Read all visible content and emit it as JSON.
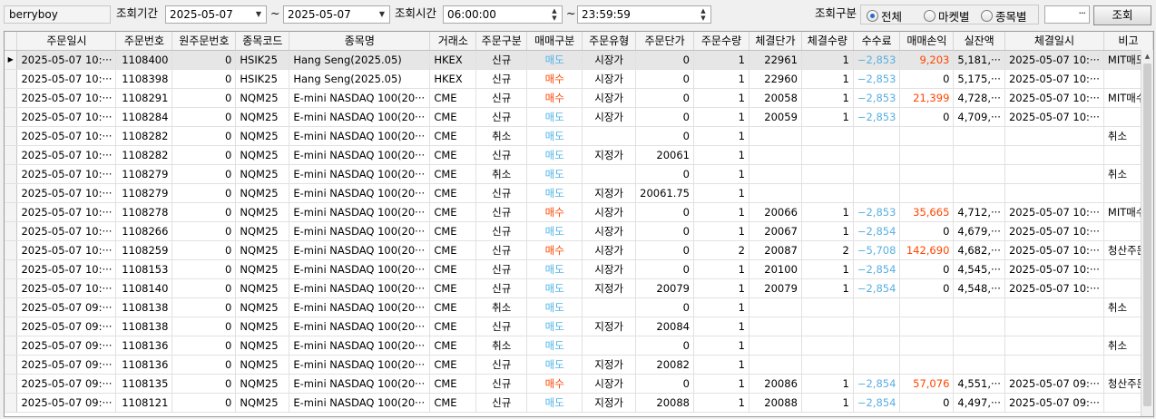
{
  "toolbar": {
    "user": "berryboy",
    "period_label": "조회기간",
    "date_from": "2025-05-07",
    "tilde": "~",
    "date_to": "2025-05-07",
    "time_label": "조회시간",
    "time_from": "06:00:00",
    "time_to": "23:59:59",
    "category_label": "조회구분",
    "radio_all": "전체",
    "radio_market": "마켓별",
    "radio_symbol": "종목별",
    "more_label": "···",
    "query_button": "조회"
  },
  "table": {
    "columns": [
      "주문일시",
      "주문번호",
      "원주문번호",
      "종목코드",
      "종목명",
      "거래소",
      "주문구분",
      "매매구분",
      "주문유형",
      "주문단가",
      "주문수량",
      "체결단가",
      "체결수량",
      "수수료",
      "매매손익",
      "실잔액",
      "체결일시",
      "비고"
    ],
    "rows": [
      {
        "order_time": "2025-05-07 10:···",
        "order_no": "1108400",
        "orig_no": "0",
        "code": "HSIK25",
        "name": "Hang Seng(2025.05)",
        "exchange": "HKEX",
        "order_type": "신규",
        "side": "매도",
        "price_type": "시장가",
        "order_price": "0",
        "order_qty": "1",
        "fill_price": "22961",
        "fill_qty": "1",
        "fee": "−2,853",
        "pl": "9,203",
        "balance": "5,181,···",
        "fill_time": "2025-05-07 10:···",
        "note": "MIT매도"
      },
      {
        "order_time": "2025-05-07 10:···",
        "order_no": "1108398",
        "orig_no": "0",
        "code": "HSIK25",
        "name": "Hang Seng(2025.05)",
        "exchange": "HKEX",
        "order_type": "신규",
        "side": "매수",
        "price_type": "시장가",
        "order_price": "0",
        "order_qty": "1",
        "fill_price": "22960",
        "fill_qty": "1",
        "fee": "−2,853",
        "pl": "0",
        "balance": "5,175,···",
        "fill_time": "2025-05-07 10:···",
        "note": ""
      },
      {
        "order_time": "2025-05-07 10:···",
        "order_no": "1108291",
        "orig_no": "0",
        "code": "NQM25",
        "name": "E-mini NASDAQ 100(20···",
        "exchange": "CME",
        "order_type": "신규",
        "side": "매수",
        "price_type": "시장가",
        "order_price": "0",
        "order_qty": "1",
        "fill_price": "20058",
        "fill_qty": "1",
        "fee": "−2,853",
        "pl": "21,399",
        "balance": "4,728,···",
        "fill_time": "2025-05-07 10:···",
        "note": "MIT매수"
      },
      {
        "order_time": "2025-05-07 10:···",
        "order_no": "1108284",
        "orig_no": "0",
        "code": "NQM25",
        "name": "E-mini NASDAQ 100(20···",
        "exchange": "CME",
        "order_type": "신규",
        "side": "매도",
        "price_type": "시장가",
        "order_price": "0",
        "order_qty": "1",
        "fill_price": "20059",
        "fill_qty": "1",
        "fee": "−2,853",
        "pl": "0",
        "balance": "4,709,···",
        "fill_time": "2025-05-07 10:···",
        "note": ""
      },
      {
        "order_time": "2025-05-07 10:···",
        "order_no": "1108282",
        "orig_no": "0",
        "code": "NQM25",
        "name": "E-mini NASDAQ 100(20···",
        "exchange": "CME",
        "order_type": "취소",
        "side": "매도",
        "price_type": "",
        "order_price": "0",
        "order_qty": "1",
        "fill_price": "",
        "fill_qty": "",
        "fee": "",
        "pl": "",
        "balance": "",
        "fill_time": "",
        "note": "취소"
      },
      {
        "order_time": "2025-05-07 10:···",
        "order_no": "1108282",
        "orig_no": "0",
        "code": "NQM25",
        "name": "E-mini NASDAQ 100(20···",
        "exchange": "CME",
        "order_type": "신규",
        "side": "매도",
        "price_type": "지정가",
        "order_price": "20061",
        "order_qty": "1",
        "fill_price": "",
        "fill_qty": "",
        "fee": "",
        "pl": "",
        "balance": "",
        "fill_time": "",
        "note": ""
      },
      {
        "order_time": "2025-05-07 10:···",
        "order_no": "1108279",
        "orig_no": "0",
        "code": "NQM25",
        "name": "E-mini NASDAQ 100(20···",
        "exchange": "CME",
        "order_type": "취소",
        "side": "매도",
        "price_type": "",
        "order_price": "0",
        "order_qty": "1",
        "fill_price": "",
        "fill_qty": "",
        "fee": "",
        "pl": "",
        "balance": "",
        "fill_time": "",
        "note": "취소"
      },
      {
        "order_time": "2025-05-07 10:···",
        "order_no": "1108279",
        "orig_no": "0",
        "code": "NQM25",
        "name": "E-mini NASDAQ 100(20···",
        "exchange": "CME",
        "order_type": "신규",
        "side": "매도",
        "price_type": "지정가",
        "order_price": "20061.75",
        "order_qty": "1",
        "fill_price": "",
        "fill_qty": "",
        "fee": "",
        "pl": "",
        "balance": "",
        "fill_time": "",
        "note": ""
      },
      {
        "order_time": "2025-05-07 10:···",
        "order_no": "1108278",
        "orig_no": "0",
        "code": "NQM25",
        "name": "E-mini NASDAQ 100(20···",
        "exchange": "CME",
        "order_type": "신규",
        "side": "매수",
        "price_type": "시장가",
        "order_price": "0",
        "order_qty": "1",
        "fill_price": "20066",
        "fill_qty": "1",
        "fee": "−2,853",
        "pl": "35,665",
        "balance": "4,712,···",
        "fill_time": "2025-05-07 10:···",
        "note": "MIT매수"
      },
      {
        "order_time": "2025-05-07 10:···",
        "order_no": "1108266",
        "orig_no": "0",
        "code": "NQM25",
        "name": "E-mini NASDAQ 100(20···",
        "exchange": "CME",
        "order_type": "신규",
        "side": "매도",
        "price_type": "시장가",
        "order_price": "0",
        "order_qty": "1",
        "fill_price": "20067",
        "fill_qty": "1",
        "fee": "−2,854",
        "pl": "0",
        "balance": "4,679,···",
        "fill_time": "2025-05-07 10:···",
        "note": ""
      },
      {
        "order_time": "2025-05-07 10:···",
        "order_no": "1108259",
        "orig_no": "0",
        "code": "NQM25",
        "name": "E-mini NASDAQ 100(20···",
        "exchange": "CME",
        "order_type": "신규",
        "side": "매수",
        "price_type": "시장가",
        "order_price": "0",
        "order_qty": "2",
        "fill_price": "20087",
        "fill_qty": "2",
        "fee": "−5,708",
        "pl": "142,690",
        "balance": "4,682,···",
        "fill_time": "2025-05-07 10:···",
        "note": "청산주문"
      },
      {
        "order_time": "2025-05-07 10:···",
        "order_no": "1108153",
        "orig_no": "0",
        "code": "NQM25",
        "name": "E-mini NASDAQ 100(20···",
        "exchange": "CME",
        "order_type": "신규",
        "side": "매도",
        "price_type": "시장가",
        "order_price": "0",
        "order_qty": "1",
        "fill_price": "20100",
        "fill_qty": "1",
        "fee": "−2,854",
        "pl": "0",
        "balance": "4,545,···",
        "fill_time": "2025-05-07 10:···",
        "note": ""
      },
      {
        "order_time": "2025-05-07 10:···",
        "order_no": "1108140",
        "orig_no": "0",
        "code": "NQM25",
        "name": "E-mini NASDAQ 100(20···",
        "exchange": "CME",
        "order_type": "신규",
        "side": "매도",
        "price_type": "지정가",
        "order_price": "20079",
        "order_qty": "1",
        "fill_price": "20079",
        "fill_qty": "1",
        "fee": "−2,854",
        "pl": "0",
        "balance": "4,548,···",
        "fill_time": "2025-05-07 10:···",
        "note": ""
      },
      {
        "order_time": "2025-05-07 09:···",
        "order_no": "1108138",
        "orig_no": "0",
        "code": "NQM25",
        "name": "E-mini NASDAQ 100(20···",
        "exchange": "CME",
        "order_type": "취소",
        "side": "매도",
        "price_type": "",
        "order_price": "0",
        "order_qty": "1",
        "fill_price": "",
        "fill_qty": "",
        "fee": "",
        "pl": "",
        "balance": "",
        "fill_time": "",
        "note": "취소"
      },
      {
        "order_time": "2025-05-07 09:···",
        "order_no": "1108138",
        "orig_no": "0",
        "code": "NQM25",
        "name": "E-mini NASDAQ 100(20···",
        "exchange": "CME",
        "order_type": "신규",
        "side": "매도",
        "price_type": "지정가",
        "order_price": "20084",
        "order_qty": "1",
        "fill_price": "",
        "fill_qty": "",
        "fee": "",
        "pl": "",
        "balance": "",
        "fill_time": "",
        "note": ""
      },
      {
        "order_time": "2025-05-07 09:···",
        "order_no": "1108136",
        "orig_no": "0",
        "code": "NQM25",
        "name": "E-mini NASDAQ 100(20···",
        "exchange": "CME",
        "order_type": "취소",
        "side": "매도",
        "price_type": "",
        "order_price": "0",
        "order_qty": "1",
        "fill_price": "",
        "fill_qty": "",
        "fee": "",
        "pl": "",
        "balance": "",
        "fill_time": "",
        "note": "취소"
      },
      {
        "order_time": "2025-05-07 09:···",
        "order_no": "1108136",
        "orig_no": "0",
        "code": "NQM25",
        "name": "E-mini NASDAQ 100(20···",
        "exchange": "CME",
        "order_type": "신규",
        "side": "매도",
        "price_type": "지정가",
        "order_price": "20082",
        "order_qty": "1",
        "fill_price": "",
        "fill_qty": "",
        "fee": "",
        "pl": "",
        "balance": "",
        "fill_time": "",
        "note": ""
      },
      {
        "order_time": "2025-05-07 09:···",
        "order_no": "1108135",
        "orig_no": "0",
        "code": "NQM25",
        "name": "E-mini NASDAQ 100(20···",
        "exchange": "CME",
        "order_type": "신규",
        "side": "매수",
        "price_type": "시장가",
        "order_price": "0",
        "order_qty": "1",
        "fill_price": "20086",
        "fill_qty": "1",
        "fee": "−2,854",
        "pl": "57,076",
        "balance": "4,551,···",
        "fill_time": "2025-05-07 09:···",
        "note": "청산주문"
      },
      {
        "order_time": "2025-05-07 09:···",
        "order_no": "1108121",
        "orig_no": "0",
        "code": "NQM25",
        "name": "E-mini NASDAQ 100(20···",
        "exchange": "CME",
        "order_type": "신규",
        "side": "매도",
        "price_type": "지정가",
        "order_price": "20088",
        "order_qty": "1",
        "fill_price": "20088",
        "fill_qty": "1",
        "fee": "−2,854",
        "pl": "0",
        "balance": "4,497,···",
        "fill_time": "2025-05-07 09:···",
        "note": ""
      }
    ]
  },
  "colors": {
    "sell": "#4fb3e8",
    "buy": "#ff4500",
    "fee": "#5aafe0",
    "profit": "#ff4500",
    "selected_row": "#e6e6e6"
  },
  "icons": {
    "row_pointer": "row-pointer-icon",
    "dropdown": "chevron-down-icon",
    "spin": "spin-arrows-icon",
    "scroll_up": "scroll-up-icon"
  }
}
